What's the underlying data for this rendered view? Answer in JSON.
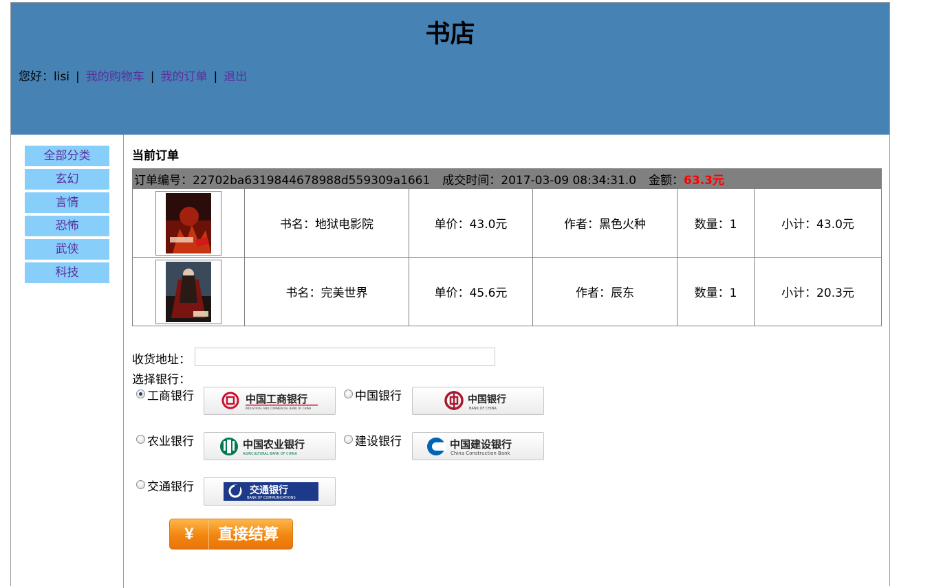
{
  "header": {
    "title": "书店",
    "greeting": "您好：lisi",
    "sep": "|",
    "links": [
      "我的购物车",
      "我的订单",
      "退出"
    ]
  },
  "sidebar": {
    "categories": [
      "全部分类",
      "玄幻",
      "言情",
      "恐怖",
      "武侠",
      "科技"
    ]
  },
  "main": {
    "section_title": "当前订单",
    "order": {
      "number_label": "订单编号：22702ba6319844678988d559309a1661",
      "time_label": "成交时间：2017-03-09 08:34:31.0",
      "amount_prefix": "金额：",
      "amount": "63.3元",
      "items": [
        {
          "name": "书名：地狱电影院",
          "price": "单价：43.0元",
          "author": "作者：黑色火种",
          "qty": "数量：1",
          "subtotal": "小计：43.0元"
        },
        {
          "name": "书名：完美世界",
          "price": "单价：45.6元",
          "author": "作者：辰东",
          "qty": "数量：1",
          "subtotal": "小计：20.3元"
        }
      ]
    },
    "address_label": "收货地址：",
    "address_value": "",
    "bank_title": "选择银行：",
    "banks": [
      {
        "label": "工商银行",
        "logo_text": "中国工商银行",
        "checked": true
      },
      {
        "label": "中国银行",
        "logo_text": "中国银行",
        "checked": false
      },
      {
        "label": "农业银行",
        "logo_text": "中国农业银行",
        "checked": false
      },
      {
        "label": "建设银行",
        "logo_text": "中国建设银行",
        "checked": false
      },
      {
        "label": "交通银行",
        "logo_text": "交通银行",
        "checked": false
      }
    ],
    "bank_logo_subtitles": {
      "icbc": "INDUSTRIAL AND COMMERCIAL BANK OF CHINA",
      "boc": "BANK OF CHINA",
      "abc": "AGRICULTURAL BANK OF CHINA",
      "ccb": "China Construction Bank",
      "bocom": "BANK OF COMMUNICATIONS"
    },
    "pay_button": {
      "symbol": "¥",
      "label": "直接结算"
    },
    "colors": {
      "header_bg": "#4682b4",
      "category_bg": "#87cefa",
      "link": "#5b2f9e",
      "amount": "#ff0000",
      "order_header_bg": "#808080",
      "pay_button": "#f2860e"
    }
  }
}
